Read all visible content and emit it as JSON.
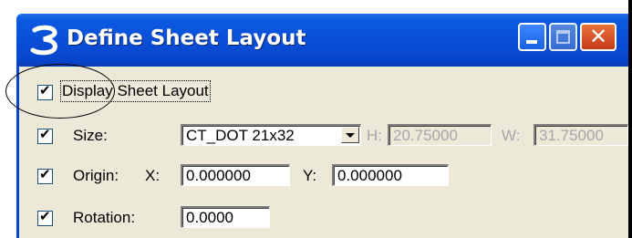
{
  "window": {
    "title": "Define Sheet Layout",
    "app_icon": "microstation-icon",
    "controls": [
      "minimize-icon",
      "maximize-icon",
      "close-icon"
    ],
    "close_glyph": "✕"
  },
  "form": {
    "display_sheet_layout": {
      "label": "Display Sheet Layout",
      "checked": true
    },
    "size": {
      "label": "Size:",
      "checked": true,
      "selected": "CT_DOT 21x32",
      "h_label": "H:",
      "h_value": "20.75000",
      "w_label": "W:",
      "w_value": "31.75000"
    },
    "origin": {
      "label": "Origin:",
      "checked": true,
      "x_label": "X:",
      "x_value": "0.000000",
      "y_label": "Y:",
      "y_value": "0.000000"
    },
    "rotation": {
      "label": "Rotation:",
      "checked": true,
      "value": "0.0000"
    }
  },
  "check_mark": "✔",
  "colors": {
    "titlebar": "#0a4fd8",
    "client": "#ece9d8",
    "close_button": "#d9532a"
  }
}
